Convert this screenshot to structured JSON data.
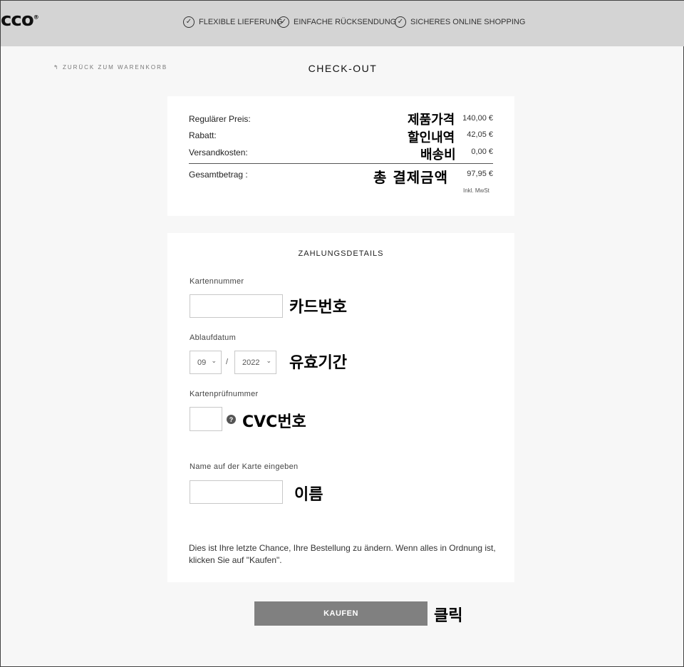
{
  "header": {
    "logo": "cco",
    "usps": [
      "FLEXIBLE LIEFERUNG",
      "EINFACHE RÜCKSENDUNG",
      "SICHERES ONLINE SHOPPING"
    ]
  },
  "nav": {
    "back_label": "ZURÜCK ZUM WARENKORB",
    "page_title": "CHECK-OUT"
  },
  "summary": {
    "regular_price": {
      "label": "Regulärer Preis:",
      "value": "140,00 €",
      "note": "제품가격"
    },
    "discount": {
      "label": "Rabatt:",
      "value": "42,05 €",
      "note": "할인내역"
    },
    "shipping": {
      "label": "Versandkosten:",
      "value": "0,00 €",
      "note": "배송비"
    },
    "total": {
      "label": "Gesamtbetrag :",
      "value": "97,95 €",
      "note": "총 결제금액",
      "tax_note": "Inkl. MwSt"
    }
  },
  "payment": {
    "heading": "ZAHLUNGSDETAILS",
    "card_number": {
      "label": "Kartennummer",
      "value": "",
      "note": "카드번호"
    },
    "expiry": {
      "label": "Ablaufdatum",
      "month": "09",
      "separator": "/",
      "year": "2022",
      "note": "유효기간"
    },
    "cvc": {
      "label": "Kartenprüfnummer",
      "value": "",
      "help": "?",
      "note": "CVC번호"
    },
    "name": {
      "label": "Name auf der Karte eingeben",
      "value": "",
      "note": "이름"
    },
    "hint": "Dies ist Ihre letzte Chance, Ihre Bestellung zu ändern. Wenn alles in Ordnung ist, klicken Sie auf \"Kaufen\"."
  },
  "actions": {
    "buy_label": "KAUFEN",
    "buy_note": "클릭"
  }
}
